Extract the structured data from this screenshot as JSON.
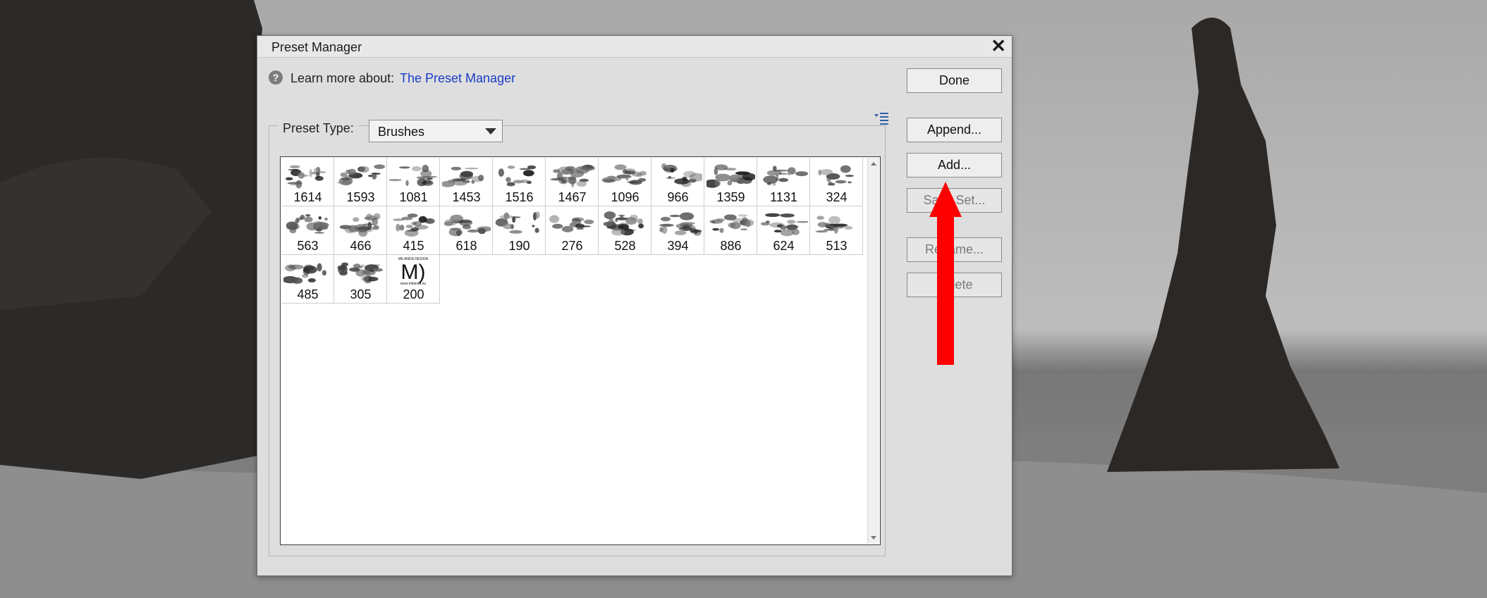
{
  "dialog": {
    "title": "Preset Manager",
    "help": {
      "label": "Learn more about:",
      "link": "The Preset Manager"
    },
    "preset_type": {
      "label": "Preset Type:",
      "value": "Brushes"
    },
    "brushes": [
      {
        "size": "1614"
      },
      {
        "size": "1593"
      },
      {
        "size": "1081"
      },
      {
        "size": "1453"
      },
      {
        "size": "1516"
      },
      {
        "size": "1467"
      },
      {
        "size": "1096"
      },
      {
        "size": "966"
      },
      {
        "size": "1359"
      },
      {
        "size": "1131"
      },
      {
        "size": "324"
      },
      {
        "size": "563"
      },
      {
        "size": "466"
      },
      {
        "size": "415"
      },
      {
        "size": "618"
      },
      {
        "size": "190"
      },
      {
        "size": "276"
      },
      {
        "size": "528"
      },
      {
        "size": "394"
      },
      {
        "size": "886"
      },
      {
        "size": "624"
      },
      {
        "size": "513"
      },
      {
        "size": "485"
      },
      {
        "size": "305"
      },
      {
        "size": "200"
      }
    ],
    "logo_brush": {
      "mark": "M)",
      "top_text": "MILANDA DESIGN",
      "bottom_text": "www.milanda.eu"
    },
    "buttons": {
      "done": "Done",
      "append": "Append...",
      "add": "Add...",
      "save_set": "Save Set...",
      "rename": "Rename...",
      "delete": "Delete"
    }
  },
  "annotation": {
    "arrow_color": "#ff0000",
    "points_to": "Add..."
  }
}
